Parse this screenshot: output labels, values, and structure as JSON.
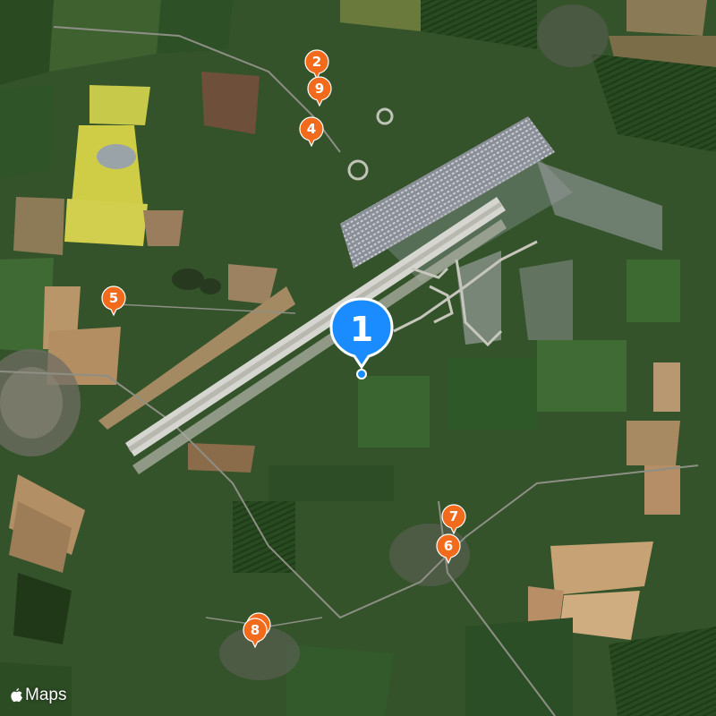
{
  "map": {
    "type": "satellite",
    "attribution_text": "Maps",
    "brand_icon": "apple-logo-icon"
  },
  "current_location": {
    "label": "1",
    "color": "#1a8cff"
  },
  "markers": [
    {
      "label": "2",
      "color": "#f26b1d"
    },
    {
      "label": "9",
      "color": "#f26b1d"
    },
    {
      "label": "4",
      "color": "#f26b1d"
    },
    {
      "label": "5",
      "color": "#f26b1d"
    },
    {
      "label": "7",
      "color": "#f26b1d"
    },
    {
      "label": "6",
      "color": "#f26b1d"
    },
    {
      "label": "8",
      "color": "#f26b1d"
    }
  ]
}
